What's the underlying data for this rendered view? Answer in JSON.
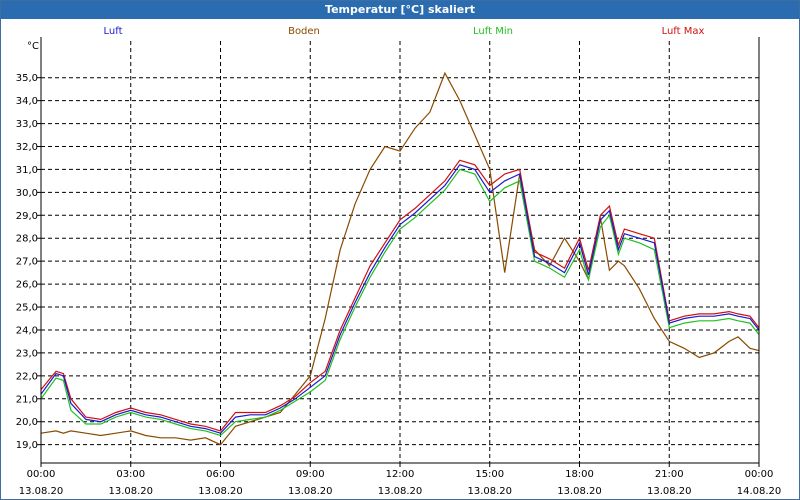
{
  "window": {
    "title": "Temperatur [°C] skaliert"
  },
  "chart_data": {
    "type": "line",
    "title": "Temperatur [°C] skaliert",
    "ylabel": "°C",
    "xlabel": "",
    "ylim": [
      18.2,
      36.6
    ],
    "xlim_hours": [
      0,
      24
    ],
    "grid": true,
    "legend_placement": "top",
    "y_ticks": [
      "19,0",
      "20,0",
      "21,0",
      "22,0",
      "23,0",
      "24,0",
      "25,0",
      "26,0",
      "27,0",
      "28,0",
      "29,0",
      "30,0",
      "31,0",
      "32,0",
      "33,0",
      "34,0",
      "35,0"
    ],
    "x_ticks": [
      {
        "time": "00:00",
        "date": "13.08.20"
      },
      {
        "time": "03:00",
        "date": "13.08.20"
      },
      {
        "time": "06:00",
        "date": "13.08.20"
      },
      {
        "time": "09:00",
        "date": "13.08.20"
      },
      {
        "time": "12:00",
        "date": "13.08.20"
      },
      {
        "time": "15:00",
        "date": "13.08.20"
      },
      {
        "time": "18:00",
        "date": "13.08.20"
      },
      {
        "time": "21:00",
        "date": "13.08.20"
      },
      {
        "time": "00:00",
        "date": "14.08.20"
      }
    ],
    "hours": [
      0,
      0.5,
      0.75,
      1,
      1.5,
      2,
      2.5,
      3,
      3.5,
      4,
      4.5,
      5,
      5.5,
      6,
      6.5,
      7,
      7.5,
      8,
      8.5,
      9,
      9.5,
      10,
      10.5,
      11,
      11.5,
      12,
      12.5,
      13,
      13.5,
      14,
      14.5,
      15,
      15.5,
      16,
      16.5,
      17,
      17.5,
      18,
      18.3,
      18.7,
      19,
      19.3,
      19.5,
      20,
      20.5,
      21,
      21.5,
      22,
      22.5,
      23,
      23.3,
      23.7,
      24
    ],
    "series": [
      {
        "name": "Luft",
        "color": "#1a1ad0",
        "values": [
          21.2,
          22.1,
          22.0,
          20.8,
          20.1,
          20.0,
          20.3,
          20.5,
          20.3,
          20.2,
          20.0,
          19.8,
          19.7,
          19.5,
          20.2,
          20.3,
          20.3,
          20.6,
          21.0,
          21.5,
          22.0,
          23.8,
          25.2,
          26.5,
          27.6,
          28.6,
          29.1,
          29.7,
          30.3,
          31.2,
          31.0,
          30.0,
          30.5,
          30.8,
          27.2,
          26.9,
          26.5,
          27.8,
          26.4,
          28.8,
          29.2,
          27.5,
          28.2,
          28.0,
          27.8,
          24.3,
          24.5,
          24.6,
          24.6,
          24.7,
          24.6,
          24.5,
          24.0
        ]
      },
      {
        "name": "Boden",
        "color": "#8a4a00",
        "values": [
          19.5,
          19.6,
          19.5,
          19.6,
          19.5,
          19.4,
          19.5,
          19.6,
          19.4,
          19.3,
          19.3,
          19.2,
          19.3,
          19.0,
          19.8,
          20.0,
          20.2,
          20.4,
          21.2,
          22.0,
          24.5,
          27.5,
          29.5,
          31.0,
          32.0,
          31.8,
          32.8,
          33.5,
          35.2,
          34.0,
          32.5,
          31.0,
          26.5,
          30.8,
          27.5,
          26.8,
          28.0,
          27.0,
          26.2,
          28.9,
          26.6,
          27.0,
          26.8,
          25.8,
          24.5,
          23.5,
          23.2,
          22.8,
          23.0,
          23.5,
          23.7,
          23.2,
          23.1
        ]
      },
      {
        "name": "Luft Min",
        "color": "#20c020",
        "values": [
          21.0,
          21.9,
          21.8,
          20.5,
          19.9,
          19.9,
          20.2,
          20.4,
          20.2,
          20.1,
          19.9,
          19.7,
          19.6,
          19.4,
          20.0,
          20.1,
          20.2,
          20.5,
          20.9,
          21.3,
          21.8,
          23.6,
          25.0,
          26.3,
          27.4,
          28.4,
          28.9,
          29.5,
          30.1,
          31.0,
          30.8,
          29.6,
          30.2,
          30.5,
          27.0,
          26.7,
          26.3,
          27.5,
          26.2,
          28.5,
          29.0,
          27.3,
          28.0,
          27.8,
          27.5,
          24.1,
          24.3,
          24.4,
          24.4,
          24.5,
          24.4,
          24.3,
          23.8
        ]
      },
      {
        "name": "Luft Max",
        "color": "#d01010",
        "values": [
          21.4,
          22.2,
          22.1,
          21.0,
          20.2,
          20.1,
          20.4,
          20.6,
          20.4,
          20.3,
          20.1,
          19.9,
          19.8,
          19.6,
          20.4,
          20.4,
          20.4,
          20.7,
          21.1,
          21.7,
          22.2,
          24.0,
          25.4,
          26.8,
          27.8,
          28.8,
          29.3,
          29.9,
          30.5,
          31.4,
          31.2,
          30.3,
          30.8,
          31.0,
          27.4,
          27.1,
          26.7,
          28.0,
          26.6,
          29.0,
          29.4,
          27.7,
          28.4,
          28.2,
          28.0,
          24.4,
          24.6,
          24.7,
          24.7,
          24.8,
          24.7,
          24.6,
          24.1
        ]
      }
    ]
  }
}
